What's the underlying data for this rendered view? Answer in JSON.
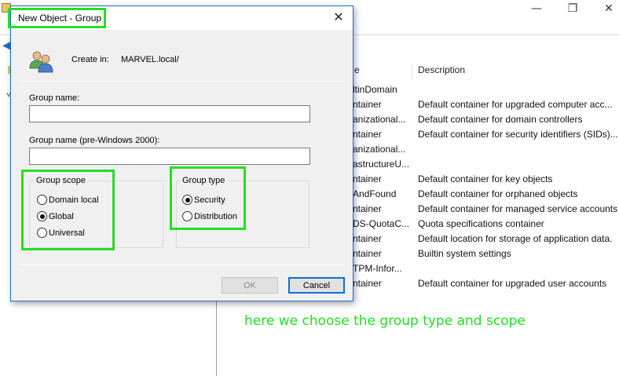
{
  "background_window": {
    "columns": {
      "name_partial": "e",
      "description": "Description"
    },
    "rows": [
      {
        "name": "ltinDomain",
        "description": ""
      },
      {
        "name": "ntainer",
        "description": "Default container for upgraded computer acc..."
      },
      {
        "name": "anizational...",
        "description": "Default container for domain controllers"
      },
      {
        "name": "ntainer",
        "description": "Default container for security identifiers (SIDs)..."
      },
      {
        "name": "anizational...",
        "description": ""
      },
      {
        "name": "astructureU...",
        "description": ""
      },
      {
        "name": "ntainer",
        "description": "Default container for key objects"
      },
      {
        "name": "AndFound",
        "description": "Default container for orphaned objects"
      },
      {
        "name": "ntainer",
        "description": "Default container for managed service accounts"
      },
      {
        "name": "DS-QuotaC...",
        "description": "Quota specifications container"
      },
      {
        "name": "ntainer",
        "description": "Default location for storage of application data."
      },
      {
        "name": "ntainer",
        "description": "Builtin system settings"
      },
      {
        "name": "TPM-Infor...",
        "description": ""
      },
      {
        "name": "ntainer",
        "description": "Default container for upgraded user accounts"
      }
    ],
    "window_controls": {
      "minimize": "—",
      "maximize": "❐",
      "close": "✕"
    }
  },
  "annotation": "here we choose the group type and scope",
  "dialog": {
    "title": "New Object - Group",
    "close_glyph": "✕",
    "create_in_label": "Create in:",
    "create_in_value": "MARVEL.local/",
    "group_name_label": "Group name:",
    "group_name_value": "",
    "group_name_pre2000_label": "Group name (pre-Windows 2000):",
    "group_name_pre2000_value": "",
    "group_scope": {
      "title": "Group scope",
      "options": [
        "Domain local",
        "Global",
        "Universal"
      ],
      "selected": "Global"
    },
    "group_type": {
      "title": "Group type",
      "options": [
        "Security",
        "Distribution"
      ],
      "selected": "Security"
    },
    "ok_label": "OK",
    "cancel_label": "Cancel"
  },
  "colors": {
    "highlight": "#22e022",
    "annotation": "#22dd22",
    "dialog_border": "#1e6fc4"
  }
}
